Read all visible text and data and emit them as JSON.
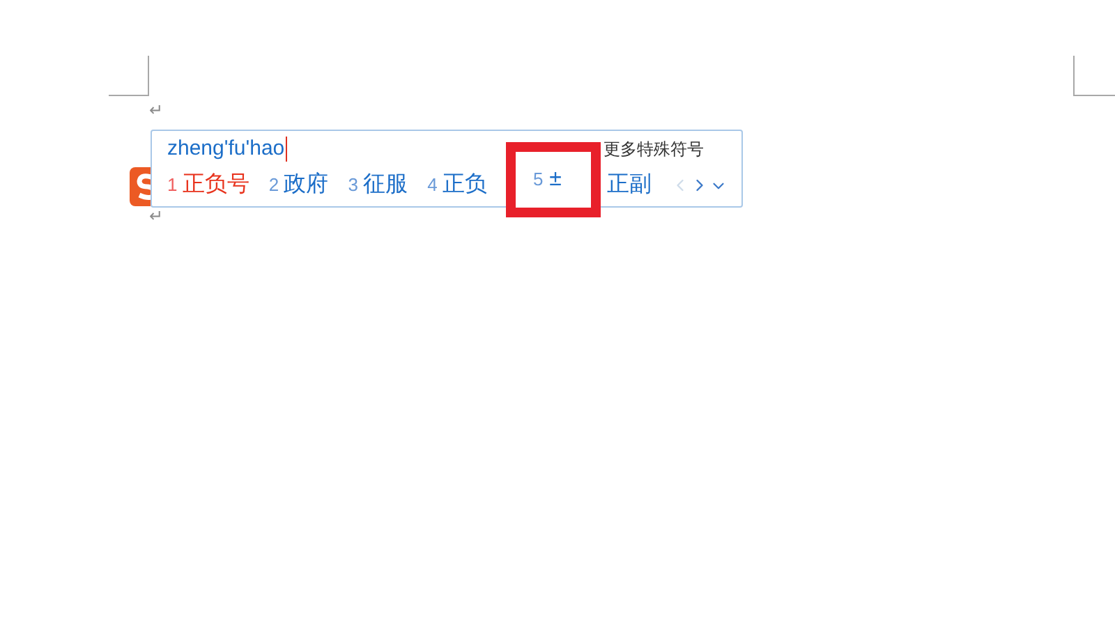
{
  "document": {
    "paragraph_marks": [
      "↵",
      "↵"
    ]
  },
  "ime": {
    "composition": "zheng'fu'hao",
    "more_symbols": "更多特殊符号",
    "candidates": [
      {
        "index": "1",
        "text": "正负号",
        "selected": true,
        "highlighted": false
      },
      {
        "index": "2",
        "text": "政府",
        "selected": false,
        "highlighted": false
      },
      {
        "index": "3",
        "text": "征服",
        "selected": false,
        "highlighted": false
      },
      {
        "index": "4",
        "text": "正负",
        "selected": false,
        "highlighted": false
      },
      {
        "index": "5",
        "text": "±",
        "selected": false,
        "highlighted": true
      },
      {
        "text": "正副",
        "selected": false,
        "highlighted": false
      }
    ],
    "prev_page": {
      "disabled": true
    },
    "next_page": {
      "disabled": false
    }
  }
}
